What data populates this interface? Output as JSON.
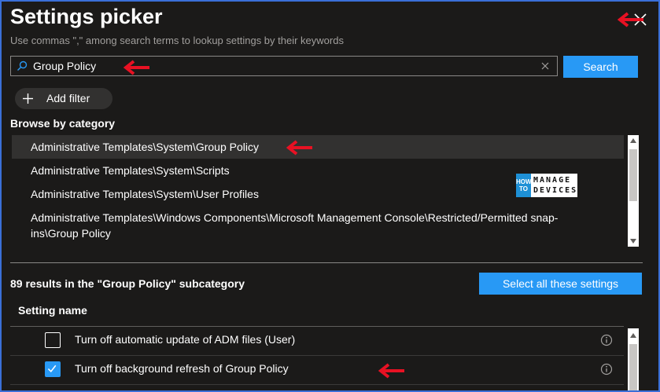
{
  "header": {
    "title": "Settings picker",
    "subtitle": "Use commas \",\" among search terms to lookup settings by their keywords"
  },
  "search": {
    "value": "Group Policy",
    "button_label": "Search"
  },
  "filter": {
    "add_label": "Add filter"
  },
  "browse": {
    "label": "Browse by category",
    "items": [
      {
        "label": "Administrative Templates\\System\\Group Policy",
        "selected": true
      },
      {
        "label": "Administrative Templates\\System\\Scripts",
        "selected": false
      },
      {
        "label": "Administrative Templates\\System\\User Profiles",
        "selected": false
      },
      {
        "label": "Administrative Templates\\Windows Components\\Microsoft Management Console\\Restricted/Permitted snap-ins\\Group Policy",
        "selected": false
      }
    ]
  },
  "results": {
    "summary": "89 results in the \"Group Policy\" subcategory",
    "select_all_label": "Select all these settings",
    "column_header": "Setting name",
    "rows": [
      {
        "name": "Turn off automatic update of ADM files (User)",
        "checked": false
      },
      {
        "name": "Turn off background refresh of Group Policy",
        "checked": true
      }
    ]
  },
  "watermark": {
    "text": "HOW TO MANAGE DEVICES"
  },
  "colors": {
    "accent": "#2899f5",
    "background": "#1b1a19",
    "annotation_arrow": "#e81123"
  },
  "icons": {
    "close": "close-icon",
    "search": "search-icon",
    "clear": "clear-icon",
    "add": "plus-icon",
    "info": "info-icon"
  }
}
